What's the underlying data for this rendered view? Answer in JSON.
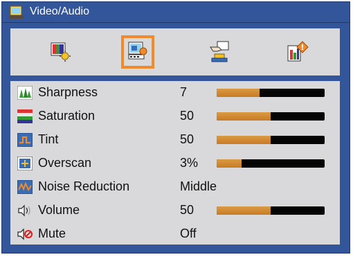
{
  "title": "Video/Audio",
  "tabs": [
    {
      "icon": "picture-brightness-icon",
      "selected": false
    },
    {
      "icon": "video-audio-icon",
      "selected": true
    },
    {
      "icon": "setup-hand-icon",
      "selected": false
    },
    {
      "icon": "options-info-icon",
      "selected": false
    }
  ],
  "items": [
    {
      "label": "Sharpness",
      "value": "7",
      "icon": "sharpness-icon",
      "level": 0.4
    },
    {
      "label": "Saturation",
      "value": "50",
      "icon": "saturation-icon",
      "level": 0.5
    },
    {
      "label": "Tint",
      "value": "50",
      "icon": "tint-icon",
      "level": 0.5
    },
    {
      "label": "Overscan",
      "value": "3%",
      "icon": "overscan-icon",
      "level": 0.23
    },
    {
      "label": "Noise Reduction",
      "value": "Middle",
      "icon": "noise-reduction-icon"
    },
    {
      "label": "Volume",
      "value": "50",
      "icon": "volume-icon",
      "level": 0.5
    },
    {
      "label": "Mute",
      "value": "Off",
      "icon": "mute-icon"
    }
  ],
  "colors": {
    "frame": "#33569a",
    "panel": "#d9d9dc",
    "highlight": "#f08a2a",
    "bar_fill": "#d1892f",
    "bar_track": "#050505"
  }
}
